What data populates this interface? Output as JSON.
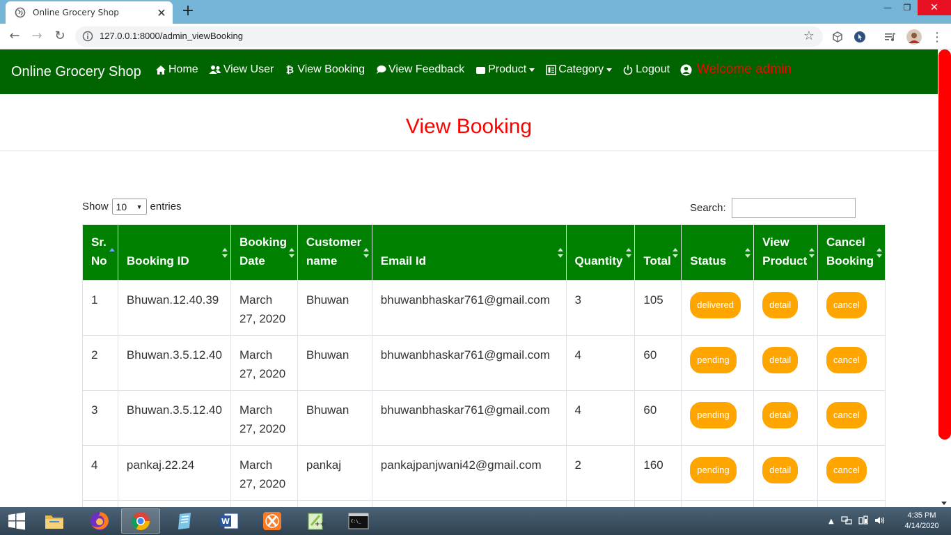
{
  "browser": {
    "tab_title": "Online Grocery Shop",
    "url": "127.0.0.1:8000/admin_viewBooking"
  },
  "navbar": {
    "brand": "Online Grocery Shop",
    "links": [
      {
        "label": "Home",
        "icon": "home-icon"
      },
      {
        "label": "View User",
        "icon": "users-icon"
      },
      {
        "label": "View Booking",
        "icon": "bitcoin-icon"
      },
      {
        "label": "View Feedback",
        "icon": "comments-icon"
      },
      {
        "label": "Product",
        "icon": "product-icon",
        "dropdown": true
      },
      {
        "label": "Category",
        "icon": "category-icon",
        "dropdown": true
      },
      {
        "label": "Logout",
        "icon": "power-icon"
      }
    ],
    "welcome": "Welcome admin"
  },
  "page": {
    "title": "View Booking"
  },
  "table_controls": {
    "show_label": "Show",
    "entries_value": "10",
    "entries_label": "entries",
    "search_label": "Search:",
    "search_value": ""
  },
  "table": {
    "headers": [
      [
        "Sr.",
        "No"
      ],
      [
        "Booking ID"
      ],
      [
        "Booking",
        "Date"
      ],
      [
        "Customer",
        "name"
      ],
      [
        "Email Id"
      ],
      [
        "Quantity"
      ],
      [
        "Total"
      ],
      [
        "Status"
      ],
      [
        "View",
        "Product"
      ],
      [
        "Cancel",
        "Booking"
      ]
    ],
    "rows": [
      {
        "sr": "1",
        "booking_id": "Bhuwan.12.40.39",
        "date_line1": "March",
        "date_line2": "27, 2020",
        "customer": "Bhuwan",
        "email": "bhuwanbhaskar761@gmail.com",
        "quantity": "3",
        "total": "105",
        "status": "delivered",
        "view": "detail",
        "cancel": "cancel"
      },
      {
        "sr": "2",
        "booking_id": "Bhuwan.3.5.12.40",
        "date_line1": "March",
        "date_line2": "27, 2020",
        "customer": "Bhuwan",
        "email": "bhuwanbhaskar761@gmail.com",
        "quantity": "4",
        "total": "60",
        "status": "pending",
        "view": "detail",
        "cancel": "cancel"
      },
      {
        "sr": "3",
        "booking_id": "Bhuwan.3.5.12.40",
        "date_line1": "March",
        "date_line2": "27, 2020",
        "customer": "Bhuwan",
        "email": "bhuwanbhaskar761@gmail.com",
        "quantity": "4",
        "total": "60",
        "status": "pending",
        "view": "detail",
        "cancel": "cancel"
      },
      {
        "sr": "4",
        "booking_id": "pankaj.22.24",
        "date_line1": "March",
        "date_line2": "27, 2020",
        "customer": "pankaj",
        "email": "pankajpanjwani42@gmail.com",
        "quantity": "2",
        "total": "160",
        "status": "pending",
        "view": "detail",
        "cancel": "cancel"
      }
    ]
  },
  "taskbar": {
    "time": "4:35 PM",
    "date": "4/14/2020",
    "apps": [
      "file-explorer-icon",
      "firefox-icon",
      "chrome-icon",
      "notes-icon",
      "word-icon",
      "xampp-icon",
      "notepad-plus-icon",
      "cmd-icon"
    ]
  },
  "colors": {
    "navbar_bg": "#006400",
    "header_bg": "#008000",
    "accent_red": "#ff0000",
    "pill_orange": "#ffa500"
  }
}
